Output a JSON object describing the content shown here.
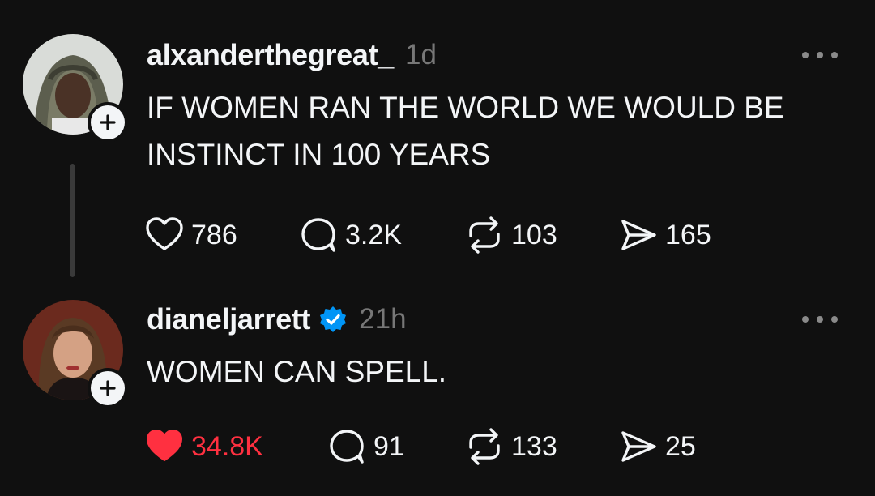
{
  "posts": [
    {
      "username": "alxanderthegreat_",
      "timestamp": "1d",
      "verified": false,
      "text": "IF WOMEN RAN THE WORLD WE WOULD BE INSTINCT IN 100 YEARS",
      "likes": "786",
      "replies": "3.2K",
      "reposts": "103",
      "shares": "165",
      "liked": false
    },
    {
      "username": "dianeljarrett",
      "timestamp": "21h",
      "verified": true,
      "text": "WOMEN CAN SPELL.",
      "likes": "34.8K",
      "replies": "91",
      "reposts": "133",
      "shares": "25",
      "liked": true
    }
  ],
  "icons": [
    "heart-icon",
    "reply-icon",
    "repost-icon",
    "share-icon",
    "more-icon",
    "verified-icon",
    "plus-icon"
  ],
  "colors": {
    "background": "#101010",
    "text": "#f3f5f7",
    "muted": "#777777",
    "like_red": "#ff3040",
    "verified_blue": "#0095f6"
  }
}
